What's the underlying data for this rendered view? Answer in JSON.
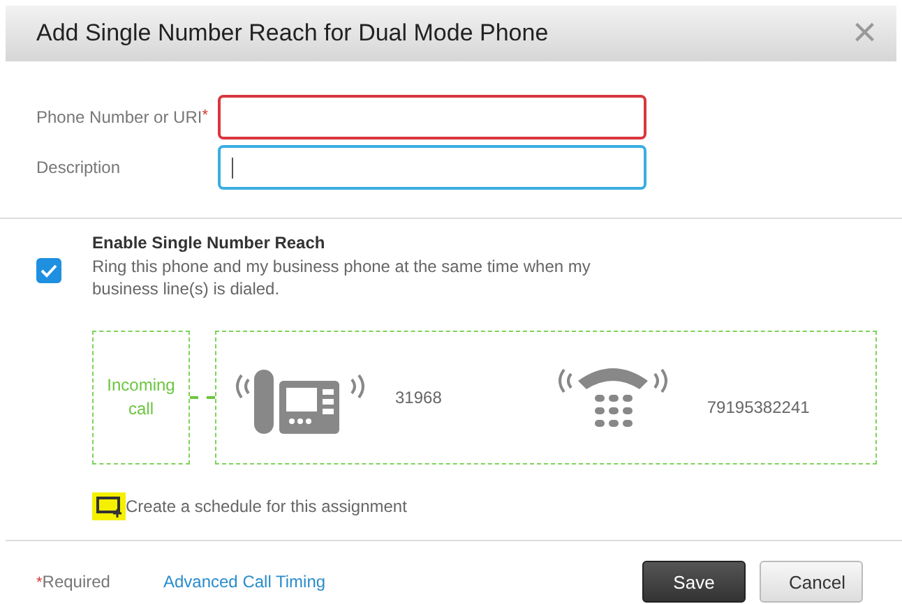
{
  "dialog": {
    "title": "Add Single Number Reach for Dual Mode Phone",
    "close": "×"
  },
  "fields": [
    {
      "label": "Phone Number or URI",
      "required_mark": "*",
      "invalid": true,
      "focused": false
    },
    {
      "label": "Description",
      "invalid": false,
      "focused": true
    }
  ],
  "enable": {
    "title": "Enable Single Number Reach",
    "description": "Ring this phone and my business phone at the same time when my business line(s) is dialed.",
    "checked": true
  },
  "diagram": {
    "incoming": "Incoming call",
    "desk_number": "31968",
    "mobile_number": "79195382241"
  },
  "schedule": {
    "label": "Create a schedule for this assignment"
  },
  "footer": {
    "required_mark": "*",
    "required": "Required",
    "link": "Advanced Call Timing",
    "buttons": [
      {
        "label": "Save",
        "kind": "primary"
      },
      {
        "label": "Cancel",
        "kind": "secondary"
      }
    ]
  }
}
